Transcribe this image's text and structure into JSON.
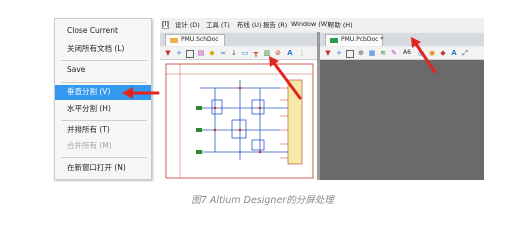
{
  "context_menu": {
    "items": [
      {
        "label": "Close Current",
        "state": "normal"
      },
      {
        "label": "关闭所有文档 (L)",
        "state": "normal"
      },
      {
        "label": "Save",
        "state": "normal"
      },
      {
        "label": "垂直分割 (V)",
        "state": "highlighted"
      },
      {
        "label": "水平分割 (H)",
        "state": "normal"
      },
      {
        "label": "并排所有 (T)",
        "state": "normal"
      },
      {
        "label": "合并所有 (M)",
        "state": "disabled"
      },
      {
        "label": "在新窗口打开 (N)",
        "state": "normal"
      }
    ],
    "highlight_color": "#3399ee"
  },
  "app": {
    "menubar": [
      "(I)",
      "设计 (D)",
      "工具 (T)",
      "布线 (U)",
      "报告 (R)",
      "Window (W)",
      "帮助 (H)"
    ],
    "tabs": [
      {
        "label": "PMU.SchDoc",
        "icon": "schematic-doc-icon",
        "icon_color": "#e8b44a"
      },
      {
        "label": "PMU.PcbDoc *",
        "icon": "pcb-doc-icon",
        "icon_color": "#2f9a4a"
      }
    ],
    "pcb_toolbar_label": "A6",
    "pcb_background": "#6a6a6a"
  },
  "annotation_color": "#e0241f",
  "caption": "图7 Altium Designer的分屏处理"
}
